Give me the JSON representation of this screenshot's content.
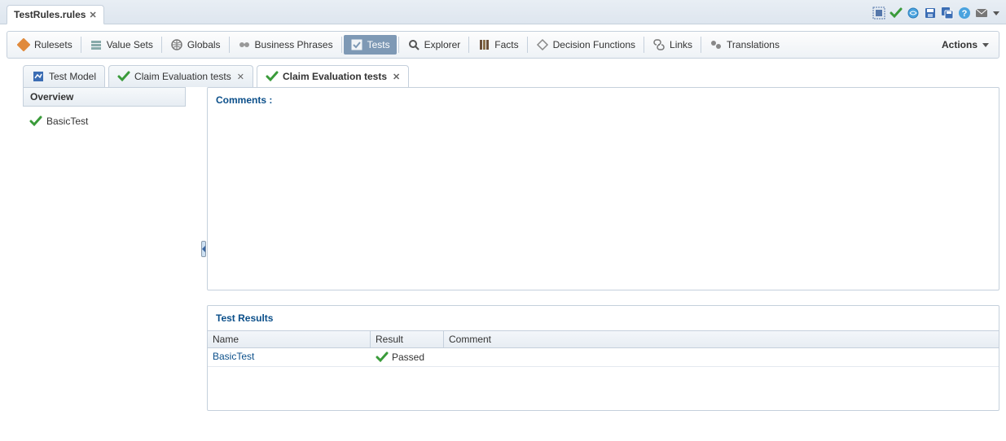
{
  "file_tab": {
    "label": "TestRules.rules"
  },
  "toolbar": {
    "rulesets": "Rulesets",
    "value_sets": "Value Sets",
    "globals": "Globals",
    "business_phrases": "Business Phrases",
    "tests": "Tests",
    "explorer": "Explorer",
    "facts": "Facts",
    "decision_functions": "Decision Functions",
    "links": "Links",
    "translations": "Translations",
    "actions": "Actions"
  },
  "sub_tabs": {
    "test_model": "Test Model",
    "claim_eval_1": "Claim Evaluation tests",
    "claim_eval_2": "Claim Evaluation tests"
  },
  "left": {
    "overview": "Overview",
    "basic_test": "BasicTest"
  },
  "comments": {
    "title": "Comments :"
  },
  "results": {
    "title": "Test Results",
    "col_name": "Name",
    "col_result": "Result",
    "col_comment": "Comment",
    "rows": [
      {
        "name": "BasicTest",
        "result": "Passed",
        "comment": ""
      }
    ]
  }
}
